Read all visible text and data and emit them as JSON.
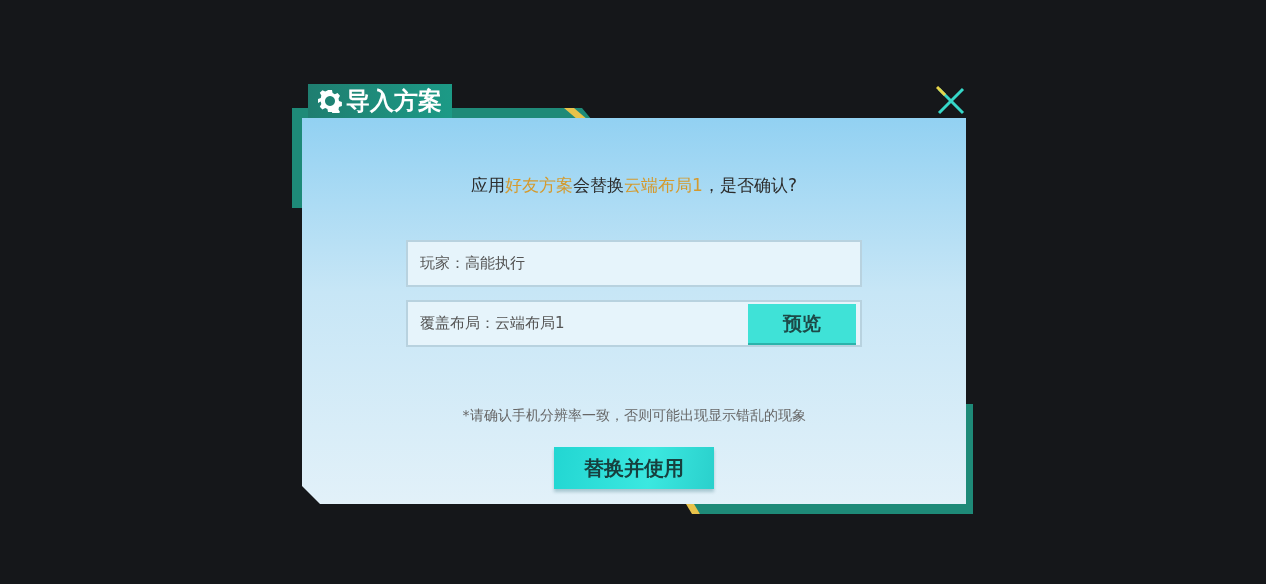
{
  "dialog": {
    "title": "导入方案",
    "message": [
      {
        "text": "应用",
        "highlight": false
      },
      {
        "text": "好友方案",
        "highlight": true
      },
      {
        "text": "会替换",
        "highlight": false
      },
      {
        "text": "云端布局1",
        "highlight": true
      },
      {
        "text": "，是否确认?",
        "highlight": false
      }
    ],
    "player_field": {
      "text": "玩家：高能执行"
    },
    "layout_field": {
      "text": "覆盖布局：云端布局1",
      "button": "预览"
    },
    "note": "*请确认手机分辨率一致，否则可能出现显示错乱的现象",
    "confirm_button": "替换并使用"
  }
}
